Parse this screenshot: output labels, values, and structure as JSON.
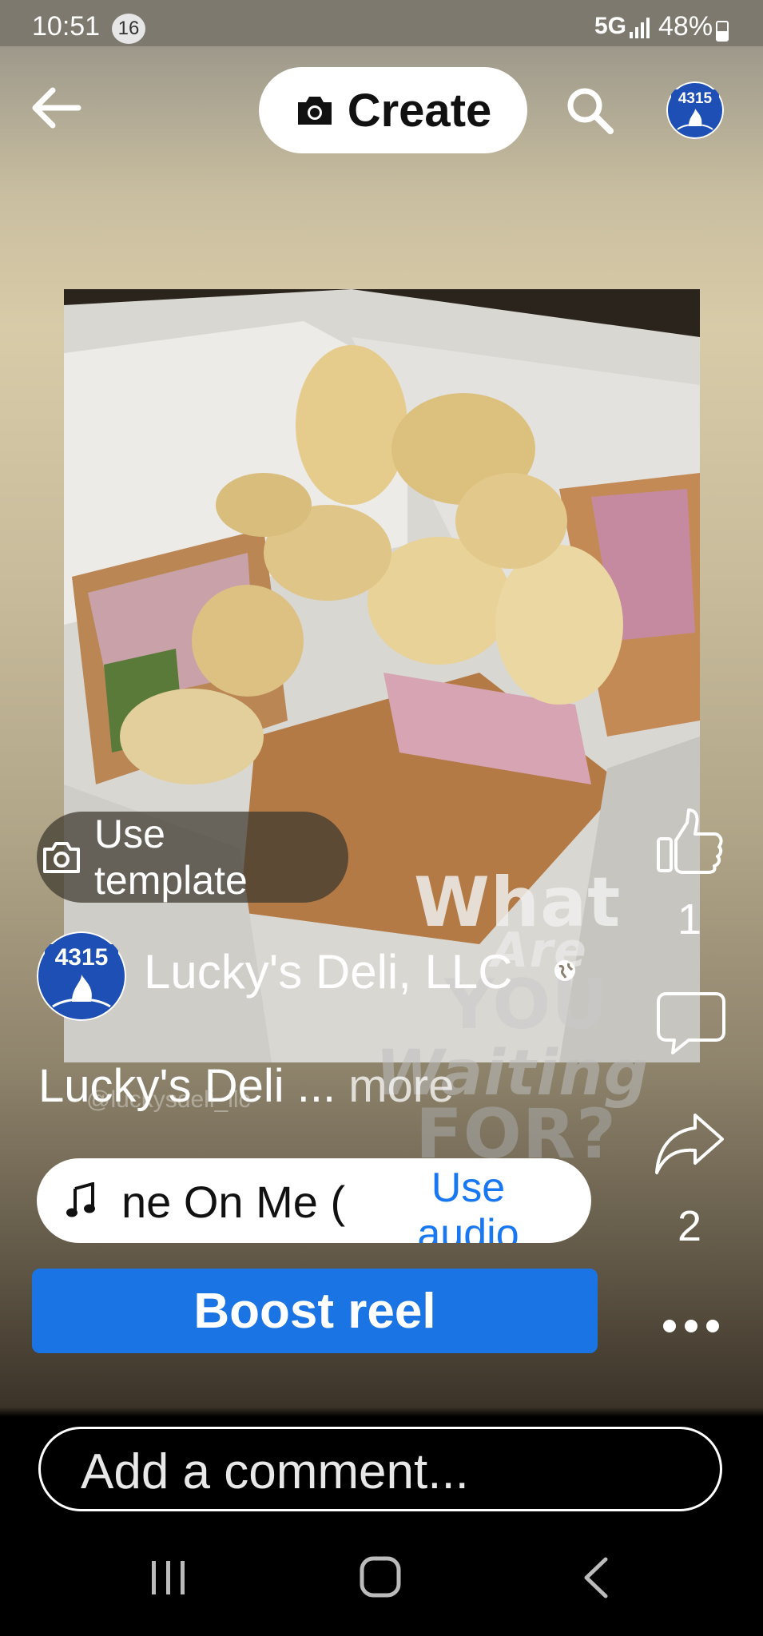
{
  "status_bar": {
    "time": "10:51",
    "notification_count": "16",
    "network": "5G",
    "battery_percent": "48%",
    "signal_icon": "signal-bars-icon",
    "battery_icon": "battery-icon"
  },
  "top_bar": {
    "back_icon": "arrow-left-icon",
    "create_label": "Create",
    "create_icon": "camera-icon",
    "search_icon": "search-icon",
    "avatar_text": "4315"
  },
  "media": {
    "overlay_lines": [
      "What",
      "Are",
      "YOU",
      "Waiting",
      "FOR?"
    ],
    "watermark": "@luckysdeli_llc"
  },
  "template": {
    "label": "Use template",
    "icon": "camera-outline-icon"
  },
  "author": {
    "name": "Lucky's Deli, LLC",
    "avatar_text": "4315",
    "privacy_icon": "globe-icon"
  },
  "caption": {
    "text": "Lucky's Deli ...",
    "more_label": "more"
  },
  "audio": {
    "title": "ne On Me (",
    "use_audio_label": "Use audio",
    "icon": "music-note-icon"
  },
  "boost": {
    "label": "Boost reel"
  },
  "actions": {
    "like_count": "1",
    "share_count": "2",
    "like_icon": "thumbs-up-icon",
    "comment_icon": "comment-bubble-icon",
    "share_icon": "share-arrow-icon",
    "more_icon": "more-dots-icon"
  },
  "comment": {
    "placeholder": "Add a comment..."
  },
  "nav": {
    "recents_icon": "recents-icon",
    "home_icon": "home-icon",
    "back_icon": "back-chevron-icon"
  },
  "colors": {
    "boost_blue": "#1b74e4",
    "link_blue": "#1877f2"
  }
}
